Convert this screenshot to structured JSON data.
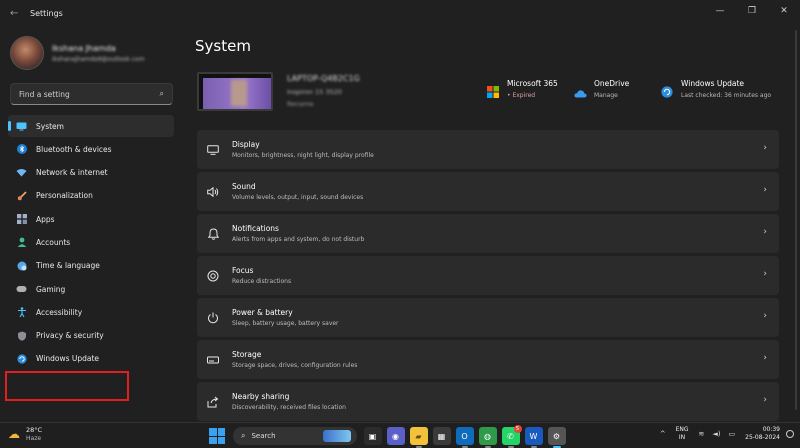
{
  "window": {
    "title": "Settings",
    "back_glyph": "←",
    "min_glyph": "—",
    "max_glyph": "❐",
    "close_glyph": "✕"
  },
  "user": {
    "name": "Ikshana Jhamda",
    "email": "ikshanajhamda9@outlook.com"
  },
  "search": {
    "placeholder": "Find a setting",
    "icon": "search-icon"
  },
  "nav": {
    "items": [
      {
        "label": "System",
        "icon": "monitor-icon",
        "active": true
      },
      {
        "label": "Bluetooth & devices",
        "icon": "bluetooth-icon"
      },
      {
        "label": "Network & internet",
        "icon": "wifi-icon"
      },
      {
        "label": "Personalization",
        "icon": "brush-icon"
      },
      {
        "label": "Apps",
        "icon": "apps-icon"
      },
      {
        "label": "Accounts",
        "icon": "person-icon"
      },
      {
        "label": "Time & language",
        "icon": "globe-clock-icon"
      },
      {
        "label": "Gaming",
        "icon": "gamepad-icon"
      },
      {
        "label": "Accessibility",
        "icon": "accessibility-icon"
      },
      {
        "label": "Privacy & security",
        "icon": "shield-icon"
      },
      {
        "label": "Windows Update",
        "icon": "update-icon",
        "highlighted": true
      }
    ]
  },
  "main": {
    "title": "System",
    "device": {
      "name": "LAPTOP-Q4B2C1G",
      "model": "Inspiron 15 3520",
      "rename": "Rename"
    },
    "quick": [
      {
        "title": "Microsoft 365",
        "sub": "• Expired",
        "icon": "microsoft-365-icon"
      },
      {
        "title": "OneDrive",
        "sub": "Manage",
        "icon": "onedrive-icon"
      },
      {
        "title": "Windows Update",
        "sub": "Last checked: 36 minutes ago",
        "icon": "windows-update-icon"
      }
    ],
    "cards": [
      {
        "title": "Display",
        "sub": "Monitors, brightness, night light, display profile",
        "icon": "display-icon"
      },
      {
        "title": "Sound",
        "sub": "Volume levels, output, input, sound devices",
        "icon": "speaker-icon"
      },
      {
        "title": "Notifications",
        "sub": "Alerts from apps and system, do not disturb",
        "icon": "bell-icon"
      },
      {
        "title": "Focus",
        "sub": "Reduce distractions",
        "icon": "focus-icon"
      },
      {
        "title": "Power & battery",
        "sub": "Sleep, battery usage, battery saver",
        "icon": "power-icon"
      },
      {
        "title": "Storage",
        "sub": "Storage space, drives, configuration rules",
        "icon": "storage-icon"
      },
      {
        "title": "Nearby sharing",
        "sub": "Discoverability, received files location",
        "icon": "share-icon"
      }
    ]
  },
  "taskbar": {
    "weather": {
      "temp": "28°C",
      "condition": "Haze",
      "icon": "weather-haze-icon"
    },
    "search_label": "Search",
    "apps": [
      {
        "name": "taskview",
        "glyph": "▣",
        "bg": "#2b2b2b"
      },
      {
        "name": "meet",
        "glyph": "◉",
        "bg": "#5b5fc7"
      },
      {
        "name": "file-explorer",
        "glyph": "▰",
        "bg": "#f2c23a"
      },
      {
        "name": "store",
        "glyph": "▦",
        "bg": "#3a3a3a"
      },
      {
        "name": "outlook",
        "glyph": "O",
        "bg": "#0f6cbd"
      },
      {
        "name": "chrome",
        "glyph": "◍",
        "bg": "#2e9a4a"
      },
      {
        "name": "whatsapp",
        "glyph": "✆",
        "bg": "#25d366",
        "badge": "5"
      },
      {
        "name": "word",
        "glyph": "W",
        "bg": "#185abd"
      },
      {
        "name": "settings",
        "glyph": "⚙",
        "bg": "#555555"
      }
    ],
    "tray": {
      "chevron": "^",
      "lang_top": "ENG",
      "lang_bottom": "IN",
      "wifi": "≋",
      "volume": "◄)",
      "battery": "▭",
      "time": "00:39",
      "date": "25-08-2024"
    }
  },
  "colors": {
    "accent": "#4cc2ff",
    "highlight_box": "#e02020",
    "background": "#202020",
    "card": "#2b2b2b"
  }
}
